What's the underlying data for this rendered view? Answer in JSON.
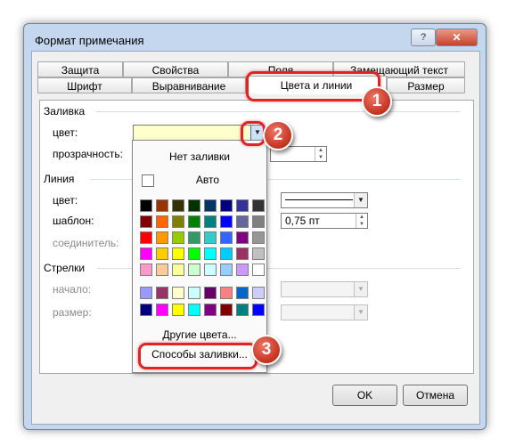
{
  "window": {
    "title": "Формат примечания",
    "help_glyph": "?",
    "close_glyph": "✕"
  },
  "tabs": {
    "row_back": [
      "Защита",
      "Свойства",
      "Поля",
      "Замещающий текст"
    ],
    "row_front": [
      "Шрифт",
      "Выравнивание",
      "Цвета и линии",
      "Размер"
    ],
    "active": "Цвета и линии"
  },
  "fill": {
    "section": "Заливка",
    "color_label": "цвет:",
    "transparency_label": "прозрачность:"
  },
  "line": {
    "section": "Линия",
    "color_label": "цвет:",
    "pattern_label": "шаблон:",
    "connector_label": "соединитель:",
    "weight_value": "0,75 пт"
  },
  "arrows": {
    "section": "Стрелки",
    "start_label": "начало:",
    "size_label": "размер:"
  },
  "popup": {
    "no_fill": "Нет заливки",
    "auto": "Авто",
    "more_colors": "Другие цвета...",
    "fill_effects": "Способы заливки...",
    "palette": [
      [
        "#000000",
        "#993300",
        "#333300",
        "#003300",
        "#003366",
        "#000080",
        "#333399",
        "#333333"
      ],
      [
        "#800000",
        "#FF6600",
        "#808000",
        "#008000",
        "#008080",
        "#0000FF",
        "#666699",
        "#808080"
      ],
      [
        "#FF0000",
        "#FF9900",
        "#99CC00",
        "#339966",
        "#33CCCC",
        "#3366FF",
        "#800080",
        "#969696"
      ],
      [
        "#FF00FF",
        "#FFCC00",
        "#FFFF00",
        "#00FF00",
        "#00FFFF",
        "#00CCFF",
        "#993366",
        "#C0C0C0"
      ],
      [
        "#FF99CC",
        "#FFCC99",
        "#FFFF99",
        "#CCFFCC",
        "#CCFFFF",
        "#99CCFF",
        "#CC99FF",
        "#FFFFFF"
      ],
      [
        "#9999FF",
        "#993366",
        "#FFFFCC",
        "#CCFFFF",
        "#660066",
        "#FF8080",
        "#0066CC",
        "#CCCCFF"
      ],
      [
        "#000080",
        "#FF00FF",
        "#FFFF00",
        "#00FFFF",
        "#800080",
        "#800000",
        "#008080",
        "#0000FF"
      ]
    ]
  },
  "buttons": {
    "ok": "OK",
    "cancel": "Отмена"
  },
  "badges": [
    "1",
    "2",
    "3"
  ],
  "accent": {
    "highlight": "#e22323",
    "selected_fill": "#ffffcc"
  }
}
